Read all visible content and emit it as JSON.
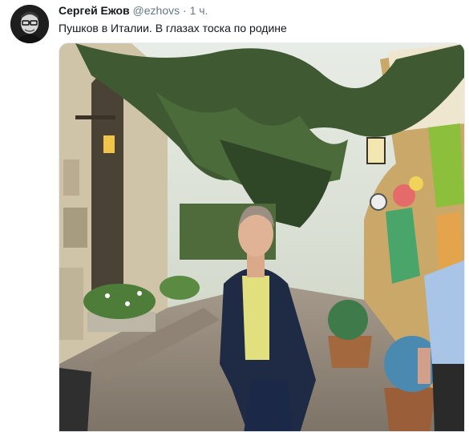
{
  "tweet": {
    "author_name": "Сергей Ежов",
    "handle": "@ezhovs",
    "separator": "·",
    "time": "1 ч.",
    "text": "Пушков в Италии. В глазах тоска по родине"
  },
  "colors": {
    "name": "#14171a",
    "meta": "#657786",
    "border": "#e6ecf0"
  },
  "icons": {
    "avatar": "avatar-image",
    "photo": "tweet-photo"
  }
}
